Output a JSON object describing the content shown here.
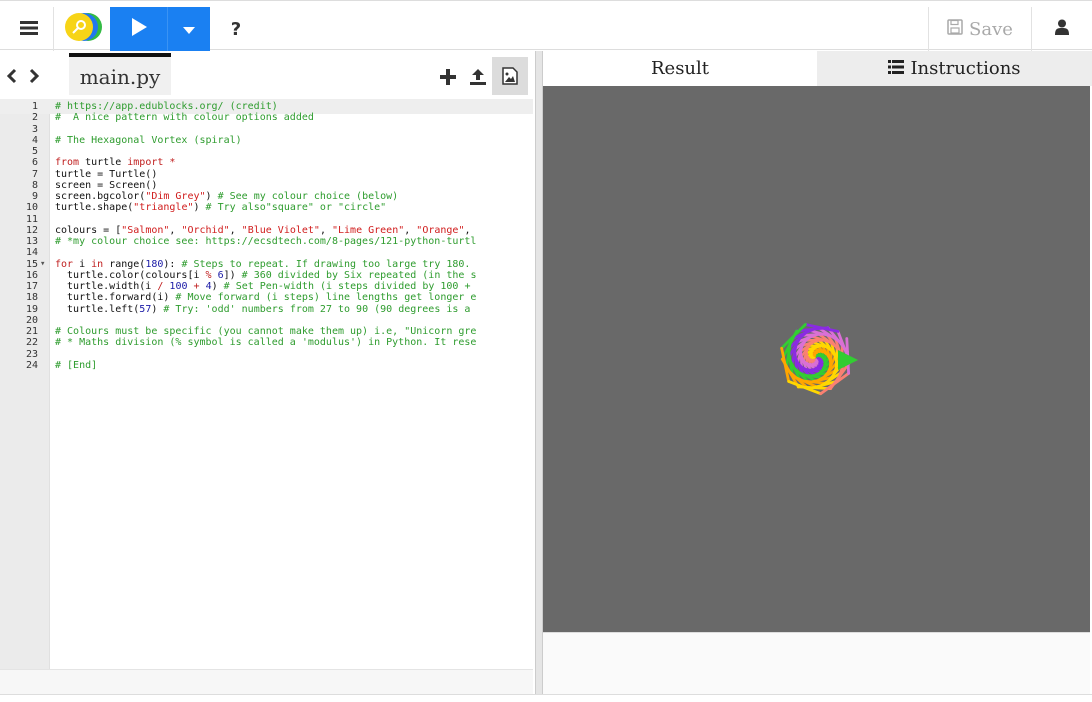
{
  "toolbar": {
    "menu_icon": "hamburger-menu-icon",
    "logo_icon": "trinket-logo-icon",
    "run_icon": "play-icon",
    "run_dropdown_icon": "caret-down-icon",
    "help_label": "?",
    "save_label": "Save",
    "save_icon": "floppy-disk-icon",
    "user_icon": "user-icon",
    "accent_color": "#1a80f2"
  },
  "editor": {
    "nav_label": "‹ ›",
    "file_tab": "main.py",
    "add_icon": "plus-icon",
    "upload_icon": "upload-icon",
    "image_icon": "image-icon",
    "lines": [
      {
        "n": "1",
        "fold": "",
        "html": "<span class=\"c-com\"># https://app.edublocks.org/ (credit)</span>"
      },
      {
        "n": "2",
        "fold": "",
        "html": "<span class=\"c-com\">#  A nice pattern with colour options added</span>"
      },
      {
        "n": "3",
        "fold": "",
        "html": ""
      },
      {
        "n": "4",
        "fold": "",
        "html": "<span class=\"c-com\"># The Hexagonal Vortex (spiral)</span>"
      },
      {
        "n": "5",
        "fold": "",
        "html": ""
      },
      {
        "n": "6",
        "fold": "",
        "html": "<span class=\"c-kw\">from</span> turtle <span class=\"c-kw\">import</span> <span class=\"c-kw\">*</span>"
      },
      {
        "n": "7",
        "fold": "",
        "html": "turtle = Turtle()"
      },
      {
        "n": "8",
        "fold": "",
        "html": "screen = Screen()"
      },
      {
        "n": "9",
        "fold": "",
        "html": "screen.bgcolor(<span class=\"c-str\">\"Dim Grey\"</span>) <span class=\"c-com\"># See my colour choice (below)</span>"
      },
      {
        "n": "10",
        "fold": "",
        "html": "turtle.shape(<span class=\"c-str\">\"triangle\"</span>) <span class=\"c-com\"># Try also\"square\" or \"circle\"</span>"
      },
      {
        "n": "11",
        "fold": "",
        "html": ""
      },
      {
        "n": "12",
        "fold": "",
        "html": "colours = [<span class=\"c-str\">\"Salmon\"</span>, <span class=\"c-str\">\"Orchid\"</span>, <span class=\"c-str\">\"Blue Violet\"</span>, <span class=\"c-str\">\"Lime Green\"</span>, <span class=\"c-str\">\"Orange\"</span>,"
      },
      {
        "n": "13",
        "fold": "",
        "html": "<span class=\"c-com\"># *my colour choice see: https://ecsdtech.com/8-pages/121-python-turtl</span>"
      },
      {
        "n": "14",
        "fold": "",
        "html": ""
      },
      {
        "n": "15",
        "fold": "▾",
        "html": "<span class=\"c-kw\">for</span> i <span class=\"c-kw\">in</span> range(<span class=\"c-num\">180</span>): <span class=\"c-com\"># Steps to repeat. If drawing too large try 180.</span>"
      },
      {
        "n": "16",
        "fold": "",
        "html": "  turtle.color(colours[i <span class=\"c-kw\">%</span> <span class=\"c-num\">6</span>]) <span class=\"c-com\"># 360 divided by Six repeated (in the s</span>"
      },
      {
        "n": "17",
        "fold": "",
        "html": "  turtle.width(i <span class=\"c-kw\">/</span> <span class=\"c-num\">100</span> <span class=\"c-kw\">+</span> <span class=\"c-num\">4</span>) <span class=\"c-com\"># Set Pen-width (i steps divided by 100 +</span>"
      },
      {
        "n": "18",
        "fold": "",
        "html": "  turtle.forward(i) <span class=\"c-com\"># Move forward (i steps) line lengths get longer e</span>"
      },
      {
        "n": "19",
        "fold": "",
        "html": "  turtle.left(<span class=\"c-num\">57</span>) <span class=\"c-com\"># Try: 'odd' numbers from 27 to 90 (90 degrees is a</span>"
      },
      {
        "n": "20",
        "fold": "",
        "html": ""
      },
      {
        "n": "21",
        "fold": "",
        "html": "<span class=\"c-com\"># Colours must be specific (you cannot make them up) i.e, \"Unicorn gre</span>"
      },
      {
        "n": "22",
        "fold": "",
        "html": "<span class=\"c-com\"># * Maths division (% symbol is called a 'modulus') in Python. It rese</span>"
      },
      {
        "n": "23",
        "fold": "",
        "html": ""
      },
      {
        "n": "24",
        "fold": "",
        "html": "<span class=\"c-com\"># [End]</span>"
      }
    ]
  },
  "output": {
    "tab_result": "Result",
    "tab_instructions": "Instructions",
    "instructions_icon": "list-icon",
    "canvas_bg": "#696969",
    "turtle_colors": [
      "#fa8072",
      "#da70d6",
      "#8a2be2",
      "#32cd32",
      "#ffa500",
      "#ffd700"
    ]
  }
}
